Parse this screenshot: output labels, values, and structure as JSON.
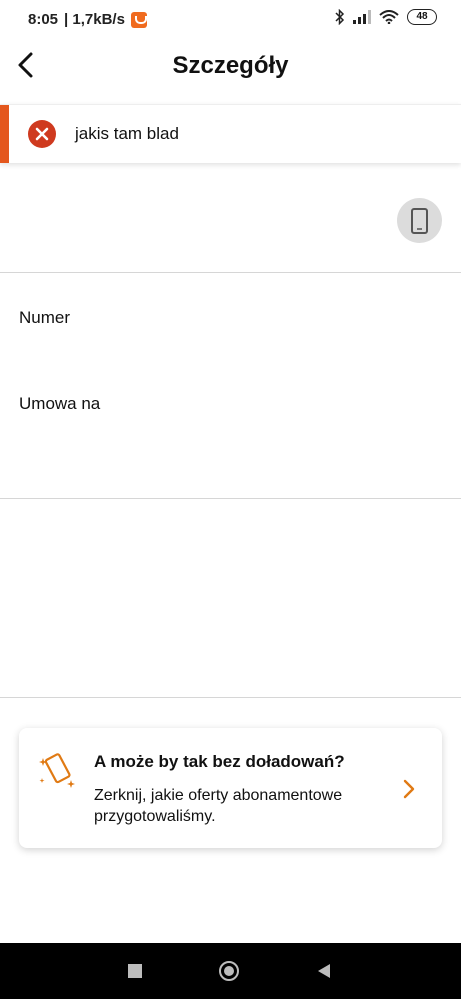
{
  "status_bar": {
    "time": "8:05",
    "speed": "| 1,7kB/s",
    "battery": "48"
  },
  "header": {
    "title": "Szczegóły",
    "back_icon": "chevron-left-icon"
  },
  "error": {
    "message": "jakis tam blad",
    "icon": "close-circle-icon",
    "color": "#e4571d"
  },
  "details": {
    "device_icon": "smartphone-icon",
    "number_label": "Numer",
    "contract_label": "Umowa na"
  },
  "promo": {
    "icon": "phone-sparkle-icon",
    "title": "A może by tak bez doładowań?",
    "description": "Zerknij, jakie oferty abonamentowe przygotowaliśmy.",
    "accent": "#e07a14"
  },
  "nav": {
    "recent_icon": "square-icon",
    "home_icon": "circle-icon",
    "back_icon": "triangle-back-icon"
  }
}
